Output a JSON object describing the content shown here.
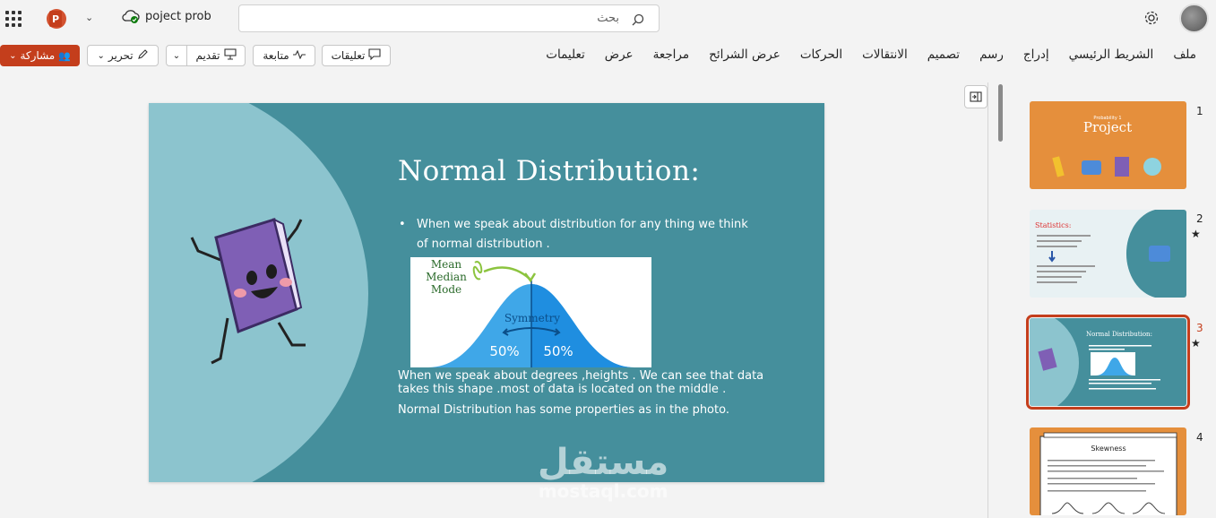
{
  "header": {
    "doc_title": "poject prob",
    "search_placeholder": "بحث"
  },
  "ribbon": {
    "share_label": "مشاركة",
    "edit_label": "تحرير",
    "present_label": "تقديم",
    "follow_label": "متابعة",
    "comments_label": "تعليقات",
    "tabs": [
      "ملف",
      "الشريط الرئيسي",
      "إدراج",
      "رسم",
      "تصميم",
      "الانتقالات",
      "الحركات",
      "عرض الشرائح",
      "مراجعة",
      "عرض",
      "تعليمات"
    ]
  },
  "slide": {
    "title": "Normal Distribution:",
    "bullet": "When we speak about distribution for any thing we think of normal distribution .",
    "para1": "When we speak about degrees ,heights . We can see that data takes this shape .most of data is located on the middle .",
    "para2": "Normal Distribution has  some properties as in the photo.",
    "chart_labels": {
      "mean": "Mean",
      "median": "Median",
      "mode": "Mode",
      "symmetry": "Symmetry",
      "left_pct": "50%",
      "right_pct": "50%"
    }
  },
  "watermark": {
    "arabic": "مستقل",
    "latin": "mostaql.com"
  },
  "thumbnails": [
    {
      "num": "1",
      "star": "",
      "title": "Project",
      "subtitle": "Probability 1"
    },
    {
      "num": "2",
      "star": "★",
      "title": "Statistics:",
      "subtitle": ""
    },
    {
      "num": "3",
      "star": "★",
      "title": "Normal Distribution:",
      "subtitle": ""
    },
    {
      "num": "4",
      "star": "",
      "title": "Skewness",
      "subtitle": ""
    }
  ],
  "colors": {
    "accent": "#c43e1c",
    "slide_bg": "#458f9c",
    "slide_arc": "#8cc4ce",
    "thumb_orange": "#e58f3c"
  }
}
